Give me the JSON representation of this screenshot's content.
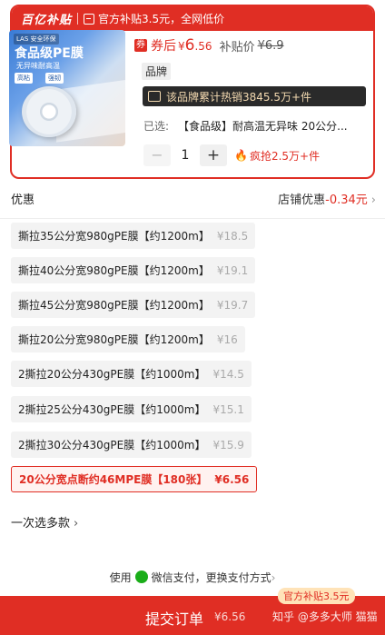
{
  "banner": {
    "brand": "百亿补贴",
    "text": "官方补贴3.5元，全网低价"
  },
  "product": {
    "image": {
      "tag": "LAS 安全环保",
      "title": "食品级PE膜",
      "subtitle": "无异味耐高温",
      "badge1": "高粘",
      "badge2": "强韧"
    },
    "coupon_icon": "券",
    "after_coupon_label": "券后",
    "price_symbol": "¥",
    "price_int": "6",
    "price_dec": ".56",
    "subsidy_label": "补贴价",
    "subsidy_price": "¥6.9",
    "brand_tag": "品牌",
    "hot_text": "该品牌累计热销3845.5万+件",
    "selected_label": "已选:",
    "selected_value": "【食品级】耐高温无异味 20公分...",
    "qty_minus": "−",
    "quantity": "1",
    "qty_plus": "+",
    "flame": "🔥",
    "grab_text": "疯抢2.5万+件"
  },
  "promo": {
    "label": "优惠",
    "right_label": "店铺优惠",
    "right_value": "-0.34元",
    "chevron": "›"
  },
  "skus": [
    {
      "name": "撕拉35公分宽980gPE膜【约1200m】",
      "price": "¥18.5"
    },
    {
      "name": "撕拉40公分宽980gPE膜【约1200m】",
      "price": "¥19.1"
    },
    {
      "name": "撕拉45公分宽980gPE膜【约1200m】",
      "price": "¥19.7"
    },
    {
      "name": "撕拉20公分宽980gPE膜【约1200m】",
      "price": "¥16"
    },
    {
      "name": "2撕拉20公分430gPE膜【约1000m】",
      "price": "¥14.5"
    },
    {
      "name": "2撕拉25公分430gPE膜【约1000m】",
      "price": "¥15.1"
    },
    {
      "name": "2撕拉30公分430gPE膜【约1000m】",
      "price": "¥15.9"
    },
    {
      "name": "20公分宽点断约46MPE膜【180张】",
      "price": "¥6.56"
    }
  ],
  "multi_select": {
    "label": "一次选多款",
    "chevron": "›"
  },
  "payment": {
    "prefix": "使用",
    "method": "微信支付，更换支付方式",
    "chevron": "›"
  },
  "submit": {
    "label": "提交订单",
    "price": "¥6.56",
    "subsidy_badge": "官方补贴3.5元",
    "watermark": "知乎 @多多大师 猫猫"
  },
  "colors": {
    "accent": "#e02e24",
    "wechat": "#1aad19"
  }
}
